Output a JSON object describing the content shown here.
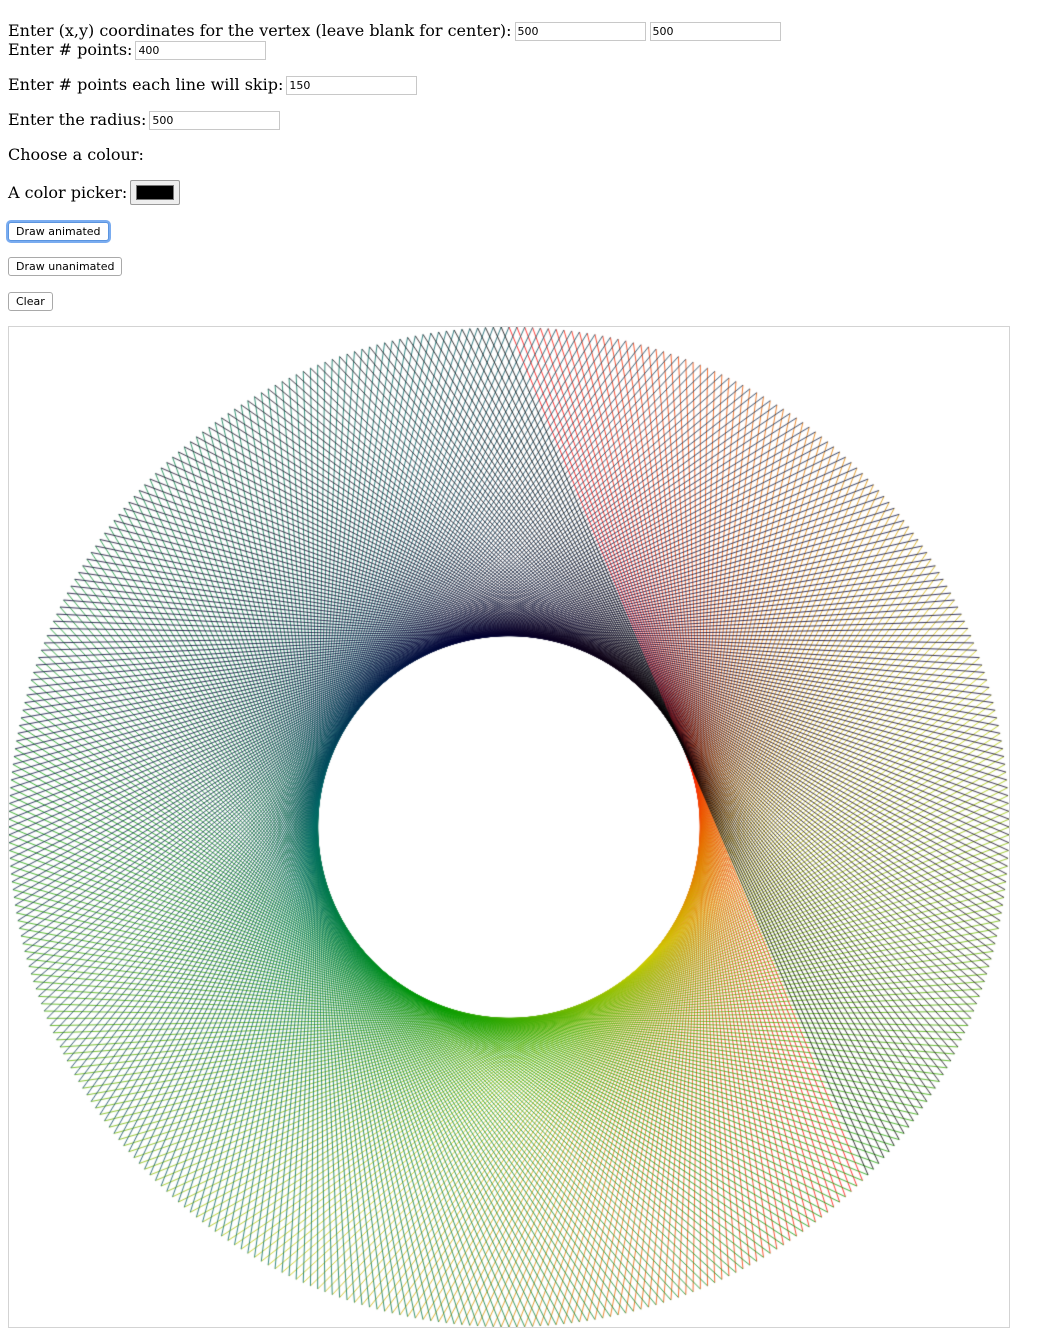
{
  "vertex": {
    "label": "Enter (x,y) coordinates for the vertex (leave blank for center):",
    "x_value": "500",
    "y_value": "500"
  },
  "points": {
    "label": "Enter # points:",
    "value": "400"
  },
  "skip": {
    "label": "Enter # points each line will skip:",
    "value": "150"
  },
  "radius": {
    "label": "Enter the radius:",
    "value": "500"
  },
  "colour": {
    "label": "Choose a colour:"
  },
  "picker": {
    "label": "A color picker:",
    "value": "#000000"
  },
  "buttons": {
    "draw_animated": "Draw animated",
    "draw_unanimated": "Draw unanimated",
    "clear": "Clear"
  }
}
